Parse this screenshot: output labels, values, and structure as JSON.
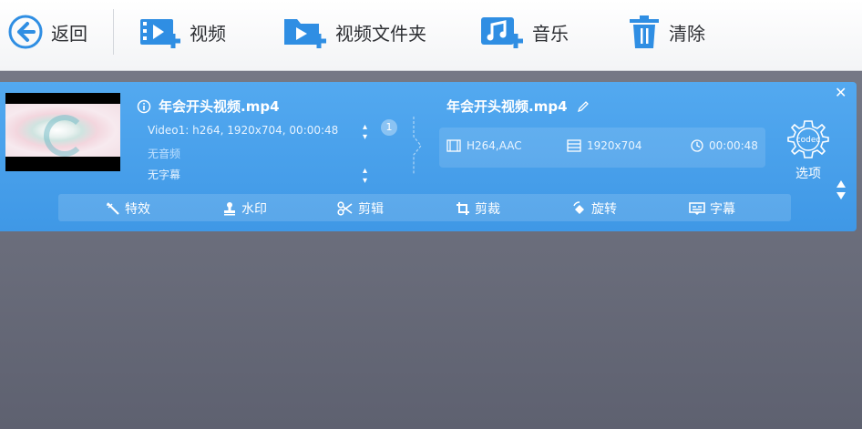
{
  "toolbar": {
    "back_label": "返回",
    "video_label": "视频",
    "folder_label": "视频文件夹",
    "music_label": "音乐",
    "clear_label": "清除"
  },
  "source": {
    "filename": "年会开头视频.mp4",
    "video_track": "Video1: h264, 1920x704, 00:00:48",
    "audio_track": "无音频",
    "subtitle_track": "无字幕",
    "track_count": "1"
  },
  "output": {
    "filename": "年会开头视频.mp4",
    "codec": "H264,AAC",
    "resolution": "1920x704",
    "duration": "00:00:48"
  },
  "codec_button": {
    "icon_text": "codec",
    "label": "选项"
  },
  "edit_tools": [
    {
      "label": "特效",
      "icon": "magic-wand-icon"
    },
    {
      "label": "水印",
      "icon": "stamp-icon"
    },
    {
      "label": "剪辑",
      "icon": "scissors-icon"
    },
    {
      "label": "剪裁",
      "icon": "crop-icon"
    },
    {
      "label": "旋转",
      "icon": "rotate-icon"
    },
    {
      "label": "字幕",
      "icon": "subtitle-icon"
    }
  ],
  "colors": {
    "accent": "#2f8ee3",
    "panel": "#4aa2ec",
    "background": "#6d707e"
  }
}
